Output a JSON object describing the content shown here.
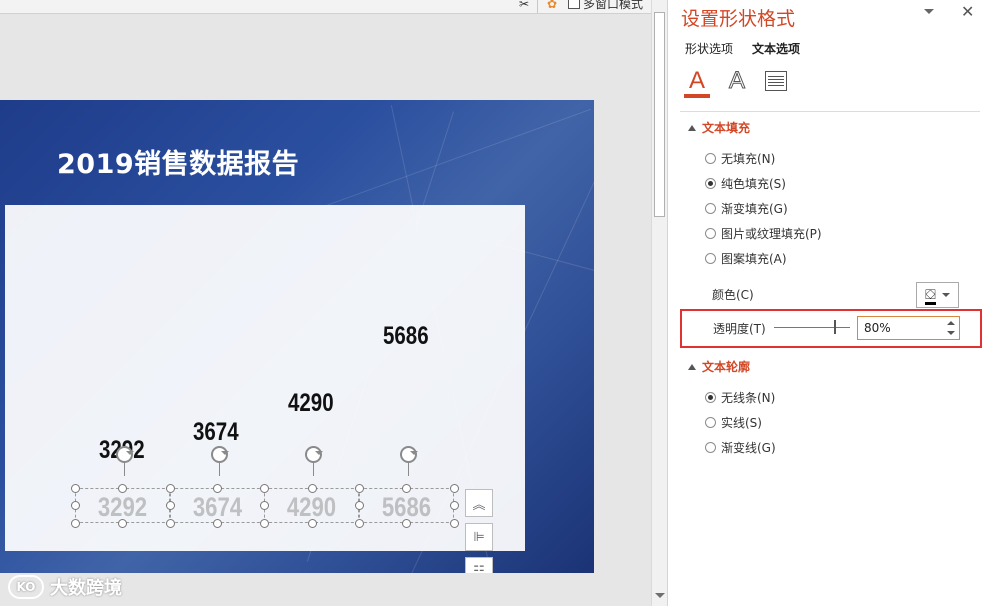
{
  "toolbar": {
    "multi_window_label": "多窗口模式"
  },
  "slide": {
    "title": "2019销售数据报告",
    "numbers": [
      "5686",
      "4290",
      "3674",
      "3292"
    ],
    "selected_values": [
      "3292",
      "3674",
      "4290",
      "5686"
    ]
  },
  "watermark": {
    "logo": "KO",
    "text": "大数跨境"
  },
  "pane": {
    "title": "设置形状格式",
    "tabs": [
      "形状选项",
      "文本选项"
    ],
    "icons": [
      "text-fill-icon",
      "text-outline-icon",
      "textbox-icon"
    ],
    "text_fill": {
      "header": "文本填充",
      "options": [
        "无填充(N)",
        "纯色填充(S)",
        "渐变填充(G)",
        "图片或纹理填充(P)",
        "图案填充(A)"
      ],
      "selected_index": 1,
      "color_label": "颜色(C)",
      "color": "#000000",
      "transparency_label": "透明度(T)",
      "transparency_value": "80%",
      "transparency_level": 0.8
    },
    "text_outline": {
      "header": "文本轮廓",
      "options": [
        "无线条(N)",
        "实线(S)",
        "渐变线(G)"
      ],
      "selected_index": 0
    }
  },
  "colors": {
    "accent": "#d24726",
    "highlight": "#e03232",
    "slide_blue": "#2b4f9f"
  }
}
